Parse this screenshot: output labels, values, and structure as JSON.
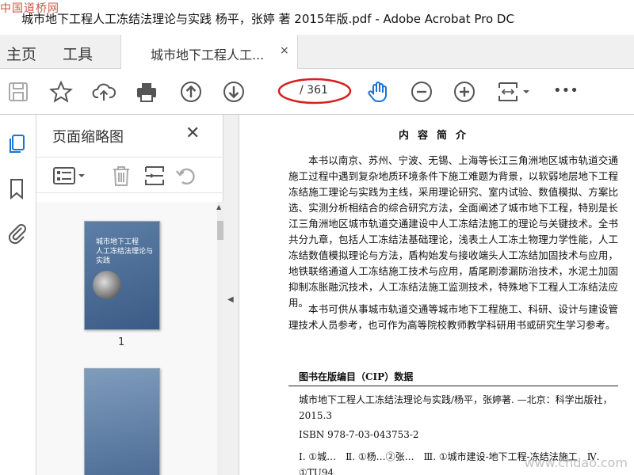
{
  "window": {
    "title": "城市地下工程人工冻结法理论与实践 杨平，张婷 著 2015年版.pdf - Adobe Acrobat Pro DC",
    "watermark_top": "中国道桥网"
  },
  "nav": {
    "home": "主页",
    "tools": "工具"
  },
  "tab": {
    "label": "城市地下工程人工...",
    "close": "×"
  },
  "toolbar": {
    "page_total": "/ 361",
    "icons": [
      "save-icon",
      "star-icon",
      "cloud-upload-icon",
      "print-icon",
      "page-up-icon",
      "page-down-icon",
      "hand-icon",
      "zoom-out-icon",
      "zoom-in-icon",
      "fit-page-icon",
      "more-icon"
    ],
    "more": "•••"
  },
  "thumb_panel": {
    "title": "页面缩略图",
    "close": "✕",
    "thumb1_title": "城市地下工程\n人工冻结法理论与实践",
    "page1": "1"
  },
  "document": {
    "heading": "内容简介",
    "para1": "本书以南京、苏州、宁波、无锡、上海等长江三角洲地区城市轨道交通施工过程中遇到复杂地质环境条件下施工难题为背景，以软弱地层地下工程冻结施工理论与实践为主线，采用理论研究、室内试验、数值模拟、方案比选、实测分析相结合的综合研究方法，全面阐述了城市地下工程，特别是长江三角洲地区城市轨道交通建设中人工冻结法施工的理论与关键技术。全书共分九章，包括人工冻结法基础理论，浅表土人工冻土物理力学性能，人工冻结数值模拟理论与方法，盾构始发与接收端头人工冻结加固技术与应用，地铁联络通道人工冻结施工技术与应用，盾尾刷渗漏防治技术，水泥土加固抑制冻胀融沉技术，人工冻结法施工监测技术，特殊地下工程人工冻结法应用。",
    "para2": "本书可供从事城市轨道交通等城市地下工程施工、科研、设计与建设管理技术人员参考，也可作为高等院校教师教学科研用书或研究生学习参考。",
    "cip_title": "图书在版编目（CIP）数据",
    "cip_line1": "城市地下工程人工冻结法理论与实践/杨平，张婷著. —北京：科学出版社，2015.3",
    "cip_isbn": "ISBN 978-7-03-043753-2",
    "cip_line3": "Ⅰ. ①城…　Ⅱ. ①杨…②张…　Ⅲ. ①城市建设-地下工程-冻结法施工　Ⅳ. ①TU94",
    "watermark_bottom": "www.chdao.com"
  }
}
